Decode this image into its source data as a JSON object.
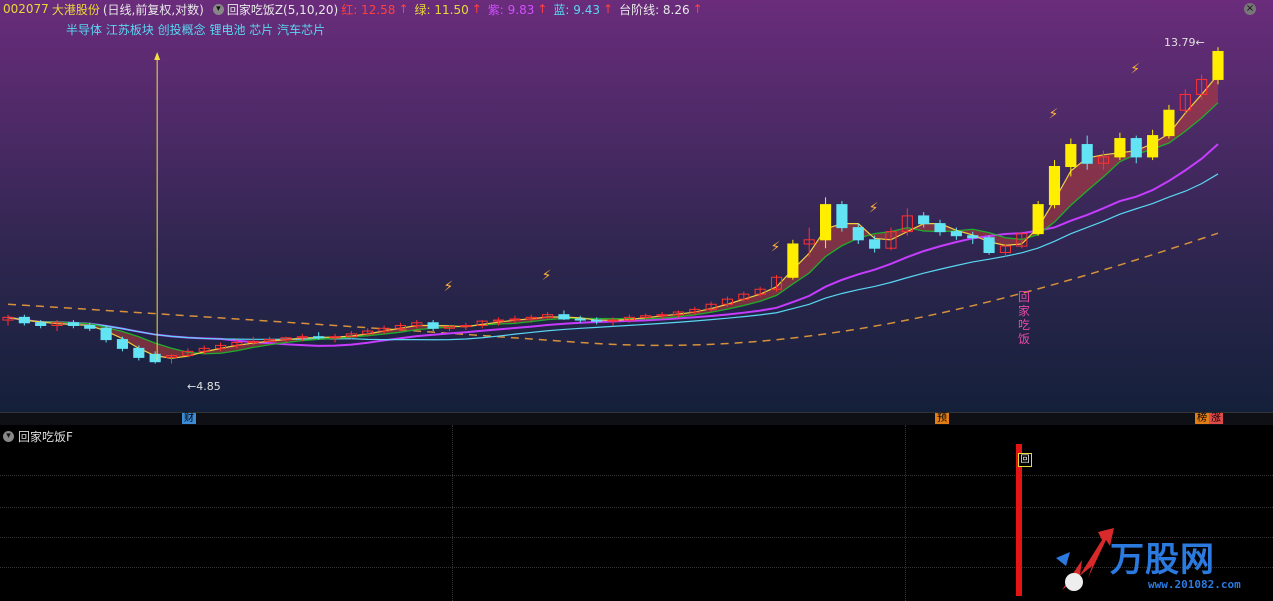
{
  "header": {
    "code": "002077",
    "name": "大港股份",
    "period": "(日线,前复权,对数)",
    "indicator": "回家吃饭Z(5,10,20)",
    "red_label": "红: 12.58",
    "green_label": "绿: 11.50",
    "purple_label": "紫: 9.83",
    "blue_label": "蓝: 9.43",
    "step_label": "台阶线: 8.26",
    "arrow": "↑"
  },
  "concepts": "半导体 江苏板块 创投概念 锂电池 芯片 汽车芯片",
  "annotations": {
    "low_price": "4.85",
    "high_price": "13.79",
    "go_home_text": "回家吃饭",
    "low_arrow": "←",
    "high_arrow": "←"
  },
  "event_markers": [
    {
      "label": "财",
      "color": "#3b8bd6"
    },
    {
      "label": "预",
      "color": "#e07d17"
    },
    {
      "label": "榜",
      "color": "#e07d17"
    },
    {
      "label": "涨",
      "color": "#e04a4a"
    }
  ],
  "subpanel": {
    "title": "回家吃饭F",
    "signal_label": "回"
  },
  "watermark": {
    "brand": "万股网",
    "url": "www.201082.com"
  },
  "colors": {
    "red_line": "#ff3030",
    "green_line": "#1fae2a",
    "purple_line": "#c63cff",
    "blue_line": "#59d7f2",
    "step_line": "#d6913a",
    "up_candle": "#ff3030",
    "down_candle": "#63e4f5",
    "yellow_candle": "#ffee00",
    "signal": "#e51414"
  },
  "chart_data": {
    "type": "candlestick",
    "candles": [
      [
        5.6,
        5.7,
        5.5,
        5.65
      ],
      [
        5.65,
        5.7,
        5.5,
        5.55
      ],
      [
        5.55,
        5.6,
        5.45,
        5.5
      ],
      [
        5.5,
        5.6,
        5.4,
        5.55
      ],
      [
        5.55,
        5.6,
        5.45,
        5.5
      ],
      [
        5.5,
        5.55,
        5.4,
        5.45
      ],
      [
        5.45,
        5.5,
        5.2,
        5.25
      ],
      [
        5.25,
        5.3,
        5.05,
        5.1
      ],
      [
        5.1,
        5.15,
        4.9,
        4.95
      ],
      [
        5.0,
        5.05,
        4.85,
        4.88
      ],
      [
        4.95,
        5.0,
        4.85,
        4.98
      ],
      [
        4.98,
        5.1,
        4.95,
        5.05
      ],
      [
        5.05,
        5.15,
        5.0,
        5.1
      ],
      [
        5.1,
        5.2,
        5.05,
        5.15
      ],
      [
        5.15,
        5.25,
        5.1,
        5.2
      ],
      [
        5.2,
        5.3,
        5.15,
        5.22
      ],
      [
        5.22,
        5.3,
        5.15,
        5.25
      ],
      [
        5.25,
        5.3,
        5.2,
        5.28
      ],
      [
        5.28,
        5.35,
        5.22,
        5.3
      ],
      [
        5.3,
        5.38,
        5.25,
        5.28
      ],
      [
        5.28,
        5.35,
        5.2,
        5.3
      ],
      [
        5.3,
        5.4,
        5.25,
        5.35
      ],
      [
        5.35,
        5.45,
        5.3,
        5.4
      ],
      [
        5.4,
        5.5,
        5.35,
        5.45
      ],
      [
        5.45,
        5.55,
        5.4,
        5.5
      ],
      [
        5.5,
        5.6,
        5.45,
        5.55
      ],
      [
        5.55,
        5.6,
        5.4,
        5.45
      ],
      [
        5.45,
        5.5,
        5.4,
        5.48
      ],
      [
        5.48,
        5.55,
        5.42,
        5.5
      ],
      [
        5.5,
        5.6,
        5.45,
        5.58
      ],
      [
        5.58,
        5.65,
        5.5,
        5.6
      ],
      [
        5.6,
        5.68,
        5.55,
        5.62
      ],
      [
        5.62,
        5.7,
        5.55,
        5.65
      ],
      [
        5.65,
        5.75,
        5.6,
        5.7
      ],
      [
        5.7,
        5.78,
        5.6,
        5.62
      ],
      [
        5.62,
        5.68,
        5.55,
        5.6
      ],
      [
        5.6,
        5.65,
        5.52,
        5.58
      ],
      [
        5.58,
        5.65,
        5.5,
        5.6
      ],
      [
        5.6,
        5.7,
        5.55,
        5.65
      ],
      [
        5.65,
        5.72,
        5.6,
        5.68
      ],
      [
        5.68,
        5.75,
        5.62,
        5.7
      ],
      [
        5.7,
        5.78,
        5.65,
        5.75
      ],
      [
        5.75,
        5.85,
        5.7,
        5.8
      ],
      [
        5.8,
        5.95,
        5.75,
        5.9
      ],
      [
        5.9,
        6.05,
        5.85,
        6.0
      ],
      [
        6.0,
        6.15,
        5.95,
        6.1
      ],
      [
        6.1,
        6.25,
        6.05,
        6.2
      ],
      [
        6.2,
        6.5,
        6.15,
        6.45
      ],
      [
        6.45,
        7.3,
        6.4,
        7.2
      ],
      [
        7.2,
        7.6,
        6.9,
        7.3
      ],
      [
        7.3,
        8.4,
        7.1,
        8.2
      ],
      [
        8.2,
        8.3,
        7.5,
        7.6
      ],
      [
        7.6,
        7.7,
        7.2,
        7.3
      ],
      [
        7.3,
        7.4,
        7.0,
        7.1
      ],
      [
        7.1,
        7.6,
        7.05,
        7.5
      ],
      [
        7.5,
        8.1,
        7.4,
        7.9
      ],
      [
        7.9,
        8.0,
        7.6,
        7.7
      ],
      [
        7.7,
        7.8,
        7.4,
        7.5
      ],
      [
        7.5,
        7.6,
        7.3,
        7.4
      ],
      [
        7.4,
        7.5,
        7.2,
        7.35
      ],
      [
        7.35,
        7.4,
        6.95,
        7.0
      ],
      [
        7.0,
        7.2,
        6.9,
        7.15
      ],
      [
        7.15,
        7.5,
        7.1,
        7.45
      ],
      [
        7.45,
        8.3,
        7.4,
        8.2
      ],
      [
        8.2,
        9.5,
        8.1,
        9.3
      ],
      [
        9.3,
        10.2,
        9.0,
        10.0
      ],
      [
        10.0,
        10.3,
        9.2,
        9.4
      ],
      [
        9.4,
        9.8,
        9.2,
        9.6
      ],
      [
        9.6,
        10.4,
        9.5,
        10.2
      ],
      [
        10.2,
        10.3,
        9.4,
        9.6
      ],
      [
        9.6,
        10.5,
        9.5,
        10.3
      ],
      [
        10.3,
        11.4,
        10.2,
        11.2
      ],
      [
        11.2,
        12.0,
        11.1,
        11.8
      ],
      [
        11.8,
        12.6,
        11.6,
        12.4
      ],
      [
        12.4,
        13.79,
        12.2,
        13.6
      ]
    ]
  }
}
